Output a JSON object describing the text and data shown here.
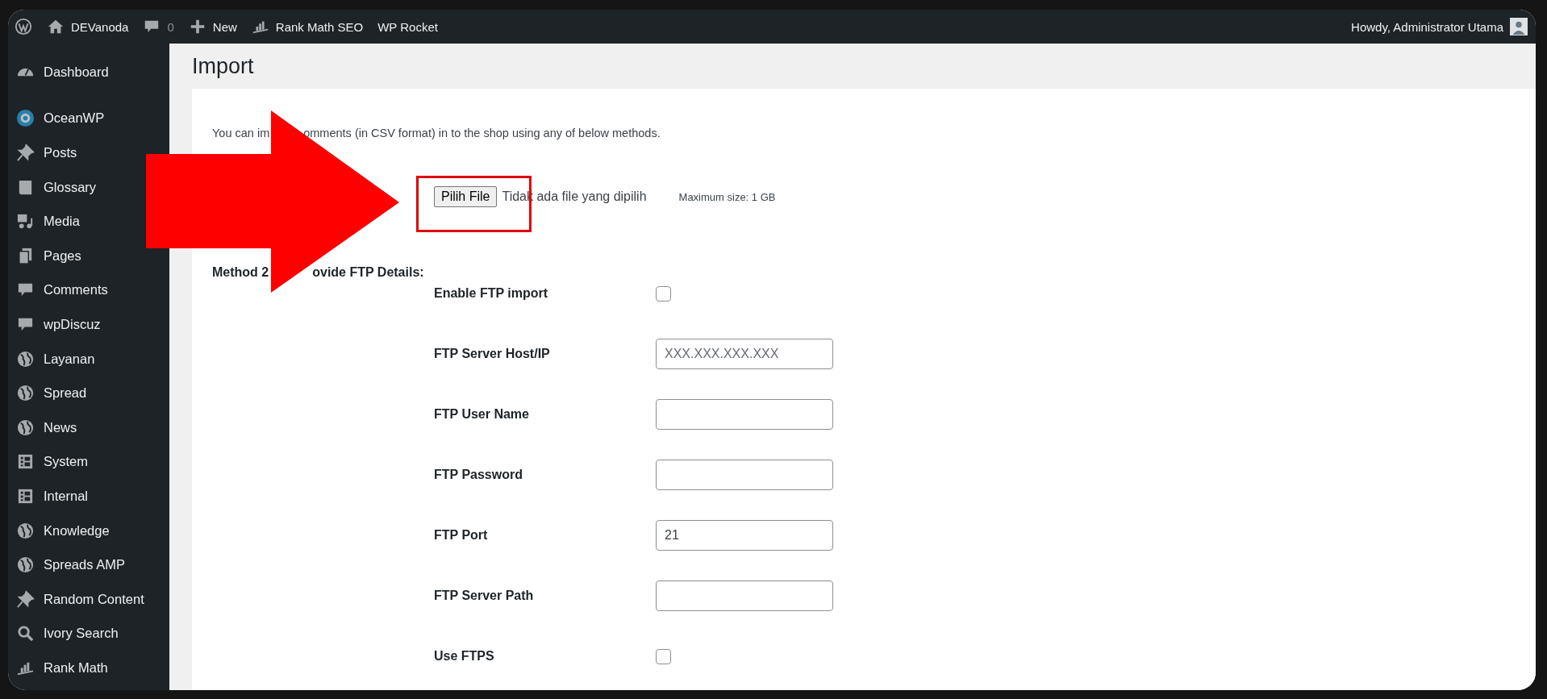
{
  "admin_bar": {
    "items": [
      {
        "kind": "wp-logo"
      },
      {
        "kind": "home",
        "label": "DEVanoda"
      },
      {
        "kind": "comments",
        "label": "0"
      },
      {
        "kind": "new",
        "label": "New"
      },
      {
        "kind": "chart",
        "label": "Rank Math SEO"
      },
      {
        "kind": "plain",
        "label": "WP Rocket"
      }
    ],
    "greeting": "Howdy, Administrator Utama"
  },
  "sidebar": {
    "groups": [
      [
        {
          "kind": "gauge",
          "label": "Dashboard"
        }
      ],
      [
        {
          "kind": "ring",
          "label": "OceanWP"
        },
        {
          "kind": "pin",
          "label": "Posts"
        },
        {
          "kind": "book",
          "label": "Glossary"
        },
        {
          "kind": "media",
          "label": "Media"
        },
        {
          "kind": "pages",
          "label": "Pages"
        },
        {
          "kind": "bubble",
          "label": "Comments"
        },
        {
          "kind": "bubble",
          "label": "wpDiscuz"
        },
        {
          "kind": "globe",
          "label": "Layanan"
        },
        {
          "kind": "globe",
          "label": "Spread"
        },
        {
          "kind": "globe",
          "label": "News"
        },
        {
          "kind": "layout",
          "label": "System"
        },
        {
          "kind": "layout",
          "label": "Internal"
        },
        {
          "kind": "globe",
          "label": "Knowledge"
        },
        {
          "kind": "globe",
          "label": "Spreads AMP"
        },
        {
          "kind": "pin",
          "label": "Random Content"
        },
        {
          "kind": "search",
          "label": "Ivory Search"
        },
        {
          "kind": "chart",
          "label": "Rank Math"
        }
      ]
    ]
  },
  "page": {
    "title": "Import",
    "intro": [
      "You can im",
      "omments (in CSV format) in to the shop using any of below methods."
    ],
    "file_button": "Pilih File",
    "file_status": "Tidak ada file yang dipilih",
    "max_size": "Maximum size: 1 GB",
    "method_heading": [
      "Method 2",
      "ovide FTP Details:"
    ],
    "fields": [
      {
        "kind": "checkbox",
        "label": "Enable FTP import",
        "checked": false
      },
      {
        "kind": "text",
        "label": "FTP Server Host/IP",
        "placeholder": "XXX.XXX.XXX.XXX"
      },
      {
        "kind": "text",
        "label": "FTP User Name"
      },
      {
        "kind": "text",
        "label": "FTP Password"
      },
      {
        "kind": "text",
        "label": "FTP Port",
        "value": "21"
      },
      {
        "kind": "text",
        "label": "FTP Server Path"
      },
      {
        "kind": "checkbox",
        "label": "Use FTPS",
        "checked": false
      }
    ]
  }
}
